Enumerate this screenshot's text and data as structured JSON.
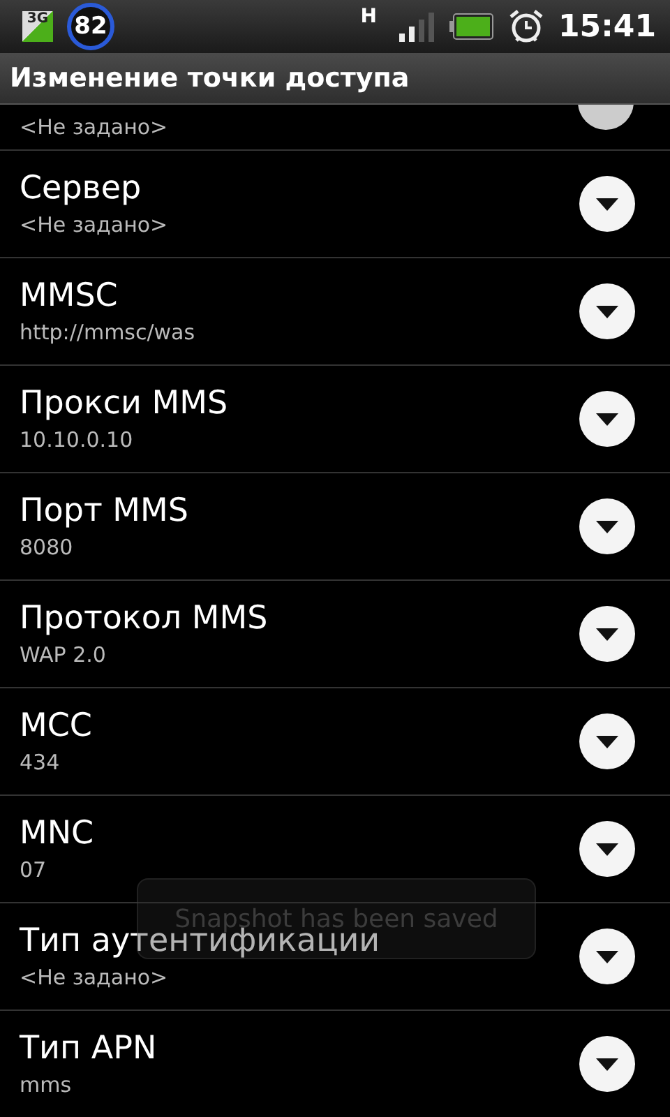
{
  "status_bar": {
    "network": "3G",
    "badge": "82",
    "data": "H",
    "time": "15:41"
  },
  "title": "Изменение точки доступа",
  "partial_row": {
    "summary": "<Не задано>"
  },
  "rows": [
    {
      "title": "Сервер",
      "summary": "<Не задано>"
    },
    {
      "title": "MMSC",
      "summary": "http://mmsc/was"
    },
    {
      "title": "Прокси MMS",
      "summary": "10.10.0.10"
    },
    {
      "title": "Порт MMS",
      "summary": "8080"
    },
    {
      "title": "Протокол MMS",
      "summary": "WAP 2.0"
    },
    {
      "title": "MCC",
      "summary": "434"
    },
    {
      "title": "MNC",
      "summary": "07"
    },
    {
      "title": "Тип аутентификации",
      "summary": "<Не задано>"
    },
    {
      "title": "Тип APN",
      "summary": "mms"
    }
  ],
  "toast": "Snapshot has been saved"
}
